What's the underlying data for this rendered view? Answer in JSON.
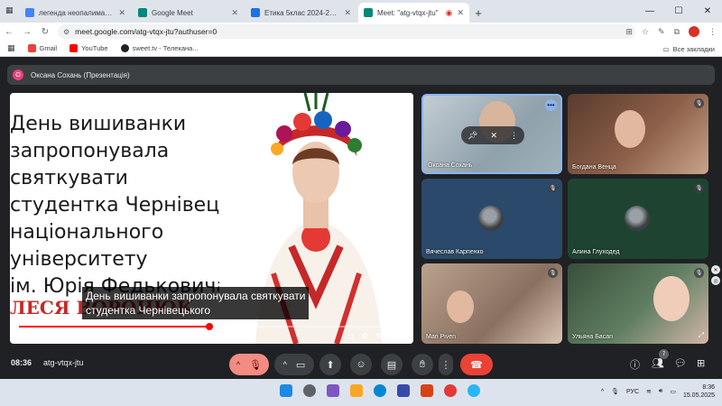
{
  "browser": {
    "tabs": [
      {
        "title": "легенда неопалима купина - ",
        "active": false,
        "favicon_color": "#4285f4"
      },
      {
        "title": "Google Meet",
        "active": false,
        "favicon_color": "#00897b"
      },
      {
        "title": "Етика 5клас 2024-2025 н.р.",
        "active": false,
        "favicon_color": "#1a73e8"
      },
      {
        "title": "Meet: \"atg-vtqx-jtu\"",
        "active": true,
        "favicon_color": "#00897b"
      }
    ],
    "new_tab_label": "+",
    "url": "meet.google.com/atg-vtqx-jtu?authuser=0",
    "bookmarks": [
      {
        "label": "Gmail",
        "color": "#ea4335"
      },
      {
        "label": "YouTube",
        "color": "#ff0000"
      },
      {
        "label": "sweet.tv - Телекана...",
        "color": "#202124"
      }
    ],
    "all_bookmarks_label": "Все закладки"
  },
  "meet": {
    "presenter_initial": "О",
    "presenter_label": "Оксана Сохань (Презентація)",
    "slide": {
      "lines": [
        "День вишиванки",
        "запропонувала",
        "святкувати",
        "студентка Чернівецького",
        "національного",
        "університету",
        "ім. Юрія Федьковича"
      ],
      "name": "ЛЕСЯ ВОРОНЮК"
    },
    "caption": [
      "День вишиванки запропонувала святкувати",
      "студентка Чернівецького"
    ],
    "video": {
      "current": "2:32",
      "total": "5:09",
      "separator": " / ",
      "progress": 0.49,
      "logo": "YouTube"
    },
    "participants": [
      {
        "name": "Оксана Сохань",
        "muted": false
      },
      {
        "name": "Богдана Венца",
        "muted": true
      },
      {
        "name": "Вячеслав Карпенко",
        "muted": true
      },
      {
        "name": "Алина Глуходед",
        "muted": true
      },
      {
        "name": "Mari Piven",
        "muted": true
      },
      {
        "name": "Ульяна Басаn",
        "muted": false
      }
    ],
    "time": "08:36",
    "meeting_code": "atg-vtqx-jtu",
    "participant_count": "7"
  },
  "system": {
    "language": "РУС",
    "time": "8:36",
    "date": "15.05.2025"
  }
}
